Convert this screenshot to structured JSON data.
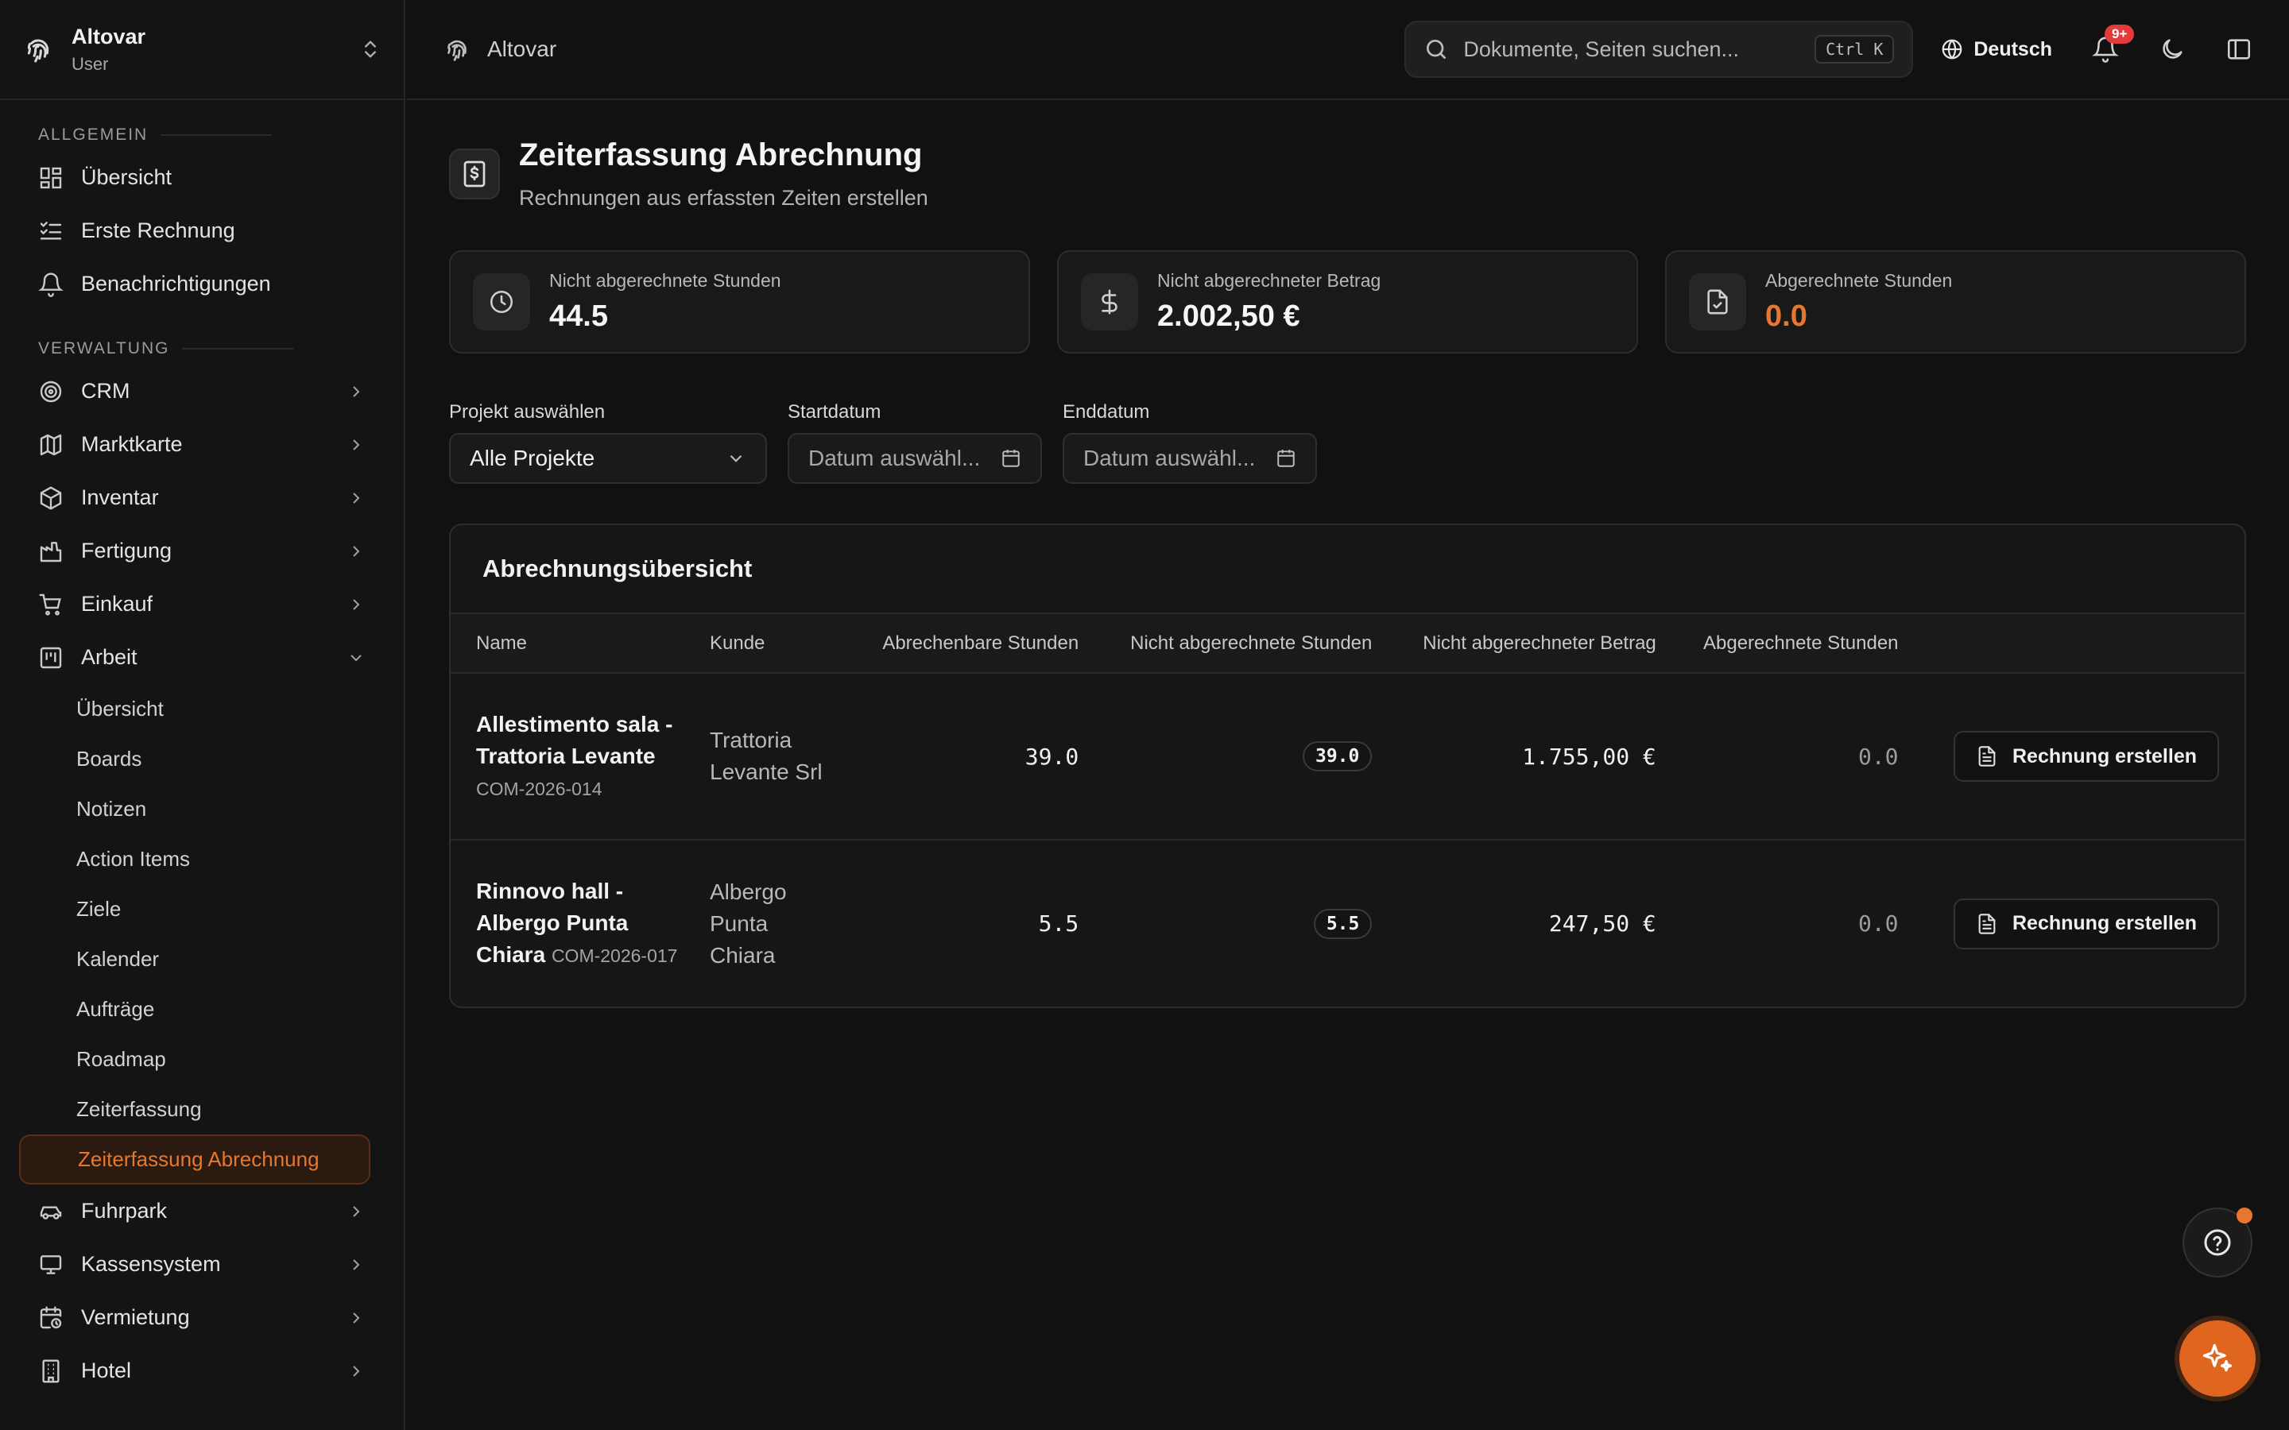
{
  "app": {
    "name": "Altovar",
    "role": "User"
  },
  "colors": {
    "accent": "#e8772e",
    "badge": "#e23b3b",
    "background": "#111111"
  },
  "sidebar": {
    "sections": [
      {
        "label": "ALLGEMEIN",
        "items": [
          {
            "label": "Übersicht",
            "icon": "dashboard-icon"
          },
          {
            "label": "Erste Rechnung",
            "icon": "list-check-icon"
          },
          {
            "label": "Benachrichtigungen",
            "icon": "bell-icon"
          }
        ]
      },
      {
        "label": "VERWALTUNG",
        "items": [
          {
            "label": "CRM",
            "icon": "target-icon"
          },
          {
            "label": "Marktkarte",
            "icon": "map-icon"
          },
          {
            "label": "Inventar",
            "icon": "box-icon"
          },
          {
            "label": "Fertigung",
            "icon": "factory-icon"
          },
          {
            "label": "Einkauf",
            "icon": "cart-icon"
          },
          {
            "label": "Arbeit",
            "icon": "kanban-icon",
            "expanded": true
          },
          {
            "label": "Fuhrpark",
            "icon": "car-icon"
          },
          {
            "label": "Kassensystem",
            "icon": "monitor-icon"
          },
          {
            "label": "Vermietung",
            "icon": "calendar-clock-icon"
          },
          {
            "label": "Hotel",
            "icon": "building-icon"
          }
        ]
      }
    ],
    "arbeit_sub": [
      "Übersicht",
      "Boards",
      "Notizen",
      "Action Items",
      "Ziele",
      "Kalender",
      "Aufträge",
      "Roadmap",
      "Zeiterfassung",
      "Zeiterfassung Abrechnung"
    ],
    "active_sub": "Zeiterfassung Abrechnung"
  },
  "topbar": {
    "breadcrumb": "Altovar",
    "search_placeholder": "Dokumente, Seiten suchen...",
    "shortcut": "Ctrl K",
    "language": "Deutsch",
    "notifications_badge": "9+"
  },
  "page": {
    "title": "Zeiterfassung Abrechnung",
    "subtitle": "Rechnungen aus erfassten Zeiten erstellen"
  },
  "stats": [
    {
      "label": "Nicht abgerechnete Stunden",
      "value": "44.5",
      "icon": "clock-icon"
    },
    {
      "label": "Nicht abgerechneter Betrag",
      "value": "2.002,50 €",
      "icon": "dollar-icon"
    },
    {
      "label": "Abgerechnete Stunden",
      "value": "0.0",
      "icon": "file-check-icon",
      "accent": true
    }
  ],
  "filters": {
    "project": {
      "label": "Projekt auswählen",
      "value": "Alle Projekte"
    },
    "start": {
      "label": "Startdatum",
      "placeholder": "Datum auswähl..."
    },
    "end": {
      "label": "Enddatum",
      "placeholder": "Datum auswähl..."
    }
  },
  "table": {
    "title": "Abrechnungsübersicht",
    "columns": [
      "Name",
      "Kunde",
      "Abrechenbare Stunden",
      "Nicht abgerechnete Stunden",
      "Nicht abgerechneter Betrag",
      "Abgerechnete Stunden"
    ],
    "action_label": "Rechnung erstellen",
    "rows": [
      {
        "name": "Allestimento sala - Trattoria Levante",
        "code": "COM-2026-014",
        "kunde": "Trattoria Levante Srl",
        "billable": "39.0",
        "unbilled_hours": "39.0",
        "unbilled_amount": "1.755,00 €",
        "billed": "0.0"
      },
      {
        "name": "Rinnovo hall - Albergo Punta Chiara",
        "code": "COM-2026-017",
        "kunde": "Albergo Punta Chiara",
        "billable": "5.5",
        "unbilled_hours": "5.5",
        "unbilled_amount": "247,50 €",
        "billed": "0.0"
      }
    ]
  }
}
